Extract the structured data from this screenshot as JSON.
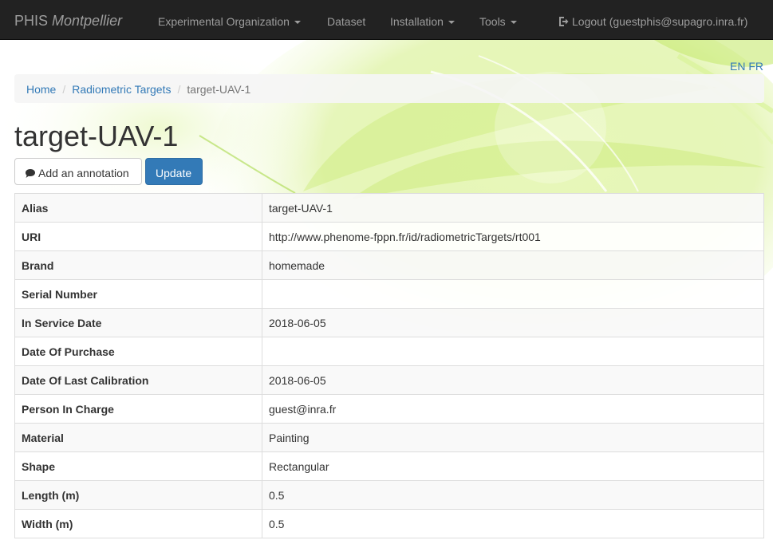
{
  "navbar": {
    "brand_name": "PHIS",
    "brand_site": "Montpellier",
    "items": [
      {
        "label": "Experimental Organization",
        "dropdown": true
      },
      {
        "label": "Dataset",
        "dropdown": false
      },
      {
        "label": "Installation",
        "dropdown": true
      },
      {
        "label": "Tools",
        "dropdown": true
      }
    ],
    "logout_label": "Logout (guestphis@supagro.inra.fr)",
    "logout_icon": "logout-icon"
  },
  "language": {
    "en": "EN",
    "fr": "FR"
  },
  "breadcrumb": {
    "home": "Home",
    "section": "Radiometric Targets",
    "current": "target-UAV-1"
  },
  "page": {
    "title": "target-UAV-1",
    "annotation_button": "Add an annotation",
    "annotation_icon": "comment-icon",
    "update_button": "Update"
  },
  "details": [
    {
      "label": "Alias",
      "value": "target-UAV-1"
    },
    {
      "label": "URI",
      "value": "http://www.phenome-fppn.fr/id/radiometricTargets/rt001"
    },
    {
      "label": "Brand",
      "value": "homemade"
    },
    {
      "label": "Serial Number",
      "value": ""
    },
    {
      "label": "In Service Date",
      "value": "2018-06-05"
    },
    {
      "label": "Date Of Purchase",
      "value": ""
    },
    {
      "label": "Date Of Last Calibration",
      "value": "2018-06-05"
    },
    {
      "label": "Person In Charge",
      "value": "guest@inra.fr"
    },
    {
      "label": "Material",
      "value": "Painting"
    },
    {
      "label": "Shape",
      "value": "Rectangular"
    },
    {
      "label": "Length (m)",
      "value": "0.5"
    },
    {
      "label": "Width (m)",
      "value": "0.5"
    }
  ],
  "colors": {
    "navbar_bg": "#222222",
    "navbar_text": "#9d9d9d",
    "link": "#337ab7",
    "primary_button": "#337ab7",
    "background_accent": "#c8ec6e"
  }
}
